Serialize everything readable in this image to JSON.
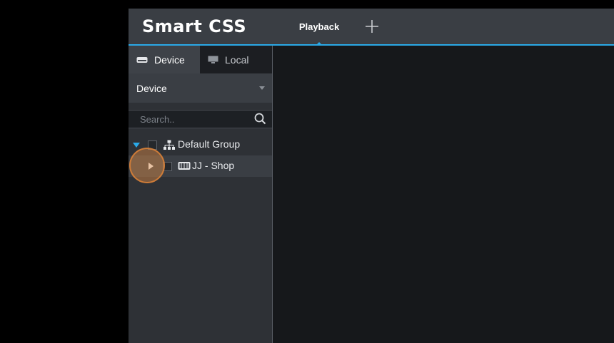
{
  "app": {
    "title": "Smart CSS"
  },
  "tabs": [
    {
      "label": "Playback",
      "active": true
    }
  ],
  "add_tab_icon": "plus-icon",
  "sidebar": {
    "tabs": [
      {
        "label": "Device",
        "icon": "device-icon",
        "active": true
      },
      {
        "label": "Local",
        "icon": "monitor-icon",
        "active": false
      }
    ],
    "dropdown": {
      "value": "Device"
    },
    "search": {
      "placeholder": "Search..",
      "value": ""
    },
    "tree": [
      {
        "label": "Default Group",
        "icon": "group-tree-icon",
        "expanded": true,
        "checked": false,
        "children": [
          {
            "label": "JJ - Shop",
            "icon": "dvr-device-icon",
            "expanded": false,
            "checked": false
          }
        ]
      }
    ]
  },
  "colors": {
    "accent": "#2aa9e8",
    "titlebar": "#3a3e44",
    "sidebar": "#2e3136",
    "content": "#16181b",
    "click_highlight": "#de8c46"
  }
}
